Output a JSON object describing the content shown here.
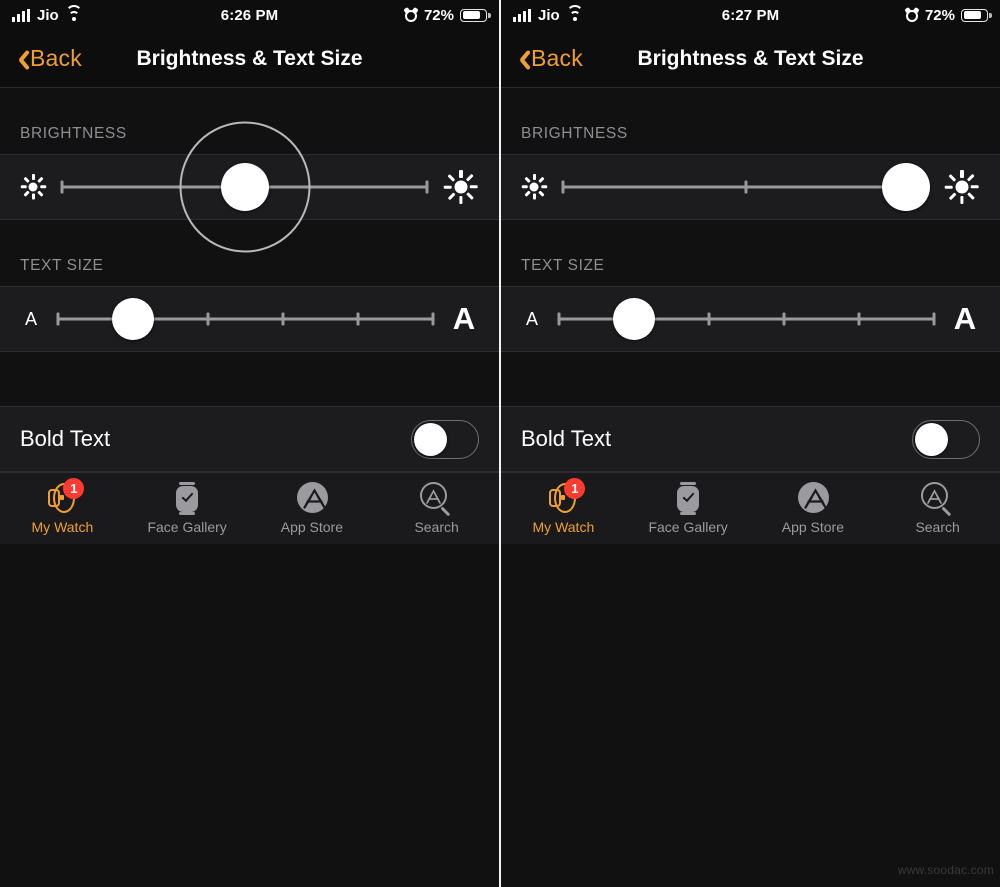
{
  "colors": {
    "accent": "#f0a030",
    "badge": "#ff3b30",
    "screen_bg": "#111111",
    "row_bg": "#1c1c1e",
    "label_gray": "#8e8e93",
    "tab_inactive": "#9a9a9f",
    "knob_white": "#ffffff"
  },
  "panels": [
    {
      "id": "left",
      "status": {
        "carrier": "Jio",
        "time": "6:26 PM",
        "battery_percent": "72%",
        "signal_icon": "signal-bars-icon",
        "wifi_icon": "wifi-icon",
        "alarm_icon": "alarm-clock-icon",
        "battery_icon": "battery-icon"
      },
      "nav": {
        "back_label": "Back",
        "back_icon": "chevron-left-icon",
        "title": "Brightness & Text Size"
      },
      "brightness": {
        "header": "BRIGHTNESS",
        "low_icon": "brightness-low-sun-icon",
        "high_icon": "brightness-high-sun-icon",
        "value_percent": 50,
        "ticks_percent": [
          0,
          100
        ],
        "touch_indicator": true
      },
      "textsize": {
        "header": "TEXT SIZE",
        "small_label": "A",
        "large_label": "A",
        "value_percent": 20,
        "ticks_percent": [
          0,
          20,
          40,
          60,
          80,
          100
        ]
      },
      "bold": {
        "label": "Bold Text",
        "state": "off"
      },
      "tabs": [
        {
          "label": "My Watch",
          "icon": "apple-watch-icon",
          "active": true,
          "badge": "1"
        },
        {
          "label": "Face Gallery",
          "icon": "watch-face-icon",
          "active": false,
          "badge": ""
        },
        {
          "label": "App Store",
          "icon": "app-store-icon",
          "active": false,
          "badge": ""
        },
        {
          "label": "Search",
          "icon": "search-store-icon",
          "active": false,
          "badge": ""
        }
      ]
    },
    {
      "id": "right",
      "status": {
        "carrier": "Jio",
        "time": "6:27 PM",
        "battery_percent": "72%",
        "signal_icon": "signal-bars-icon",
        "wifi_icon": "wifi-icon",
        "alarm_icon": "alarm-clock-icon",
        "battery_icon": "battery-icon"
      },
      "nav": {
        "back_label": "Back",
        "back_icon": "chevron-left-icon",
        "title": "Brightness & Text Size"
      },
      "brightness": {
        "header": "BRIGHTNESS",
        "low_icon": "brightness-low-sun-icon",
        "high_icon": "brightness-high-sun-icon",
        "value_percent": 94,
        "ticks_percent": [
          0,
          50
        ],
        "touch_indicator": false
      },
      "textsize": {
        "header": "TEXT SIZE",
        "small_label": "A",
        "large_label": "A",
        "value_percent": 20,
        "ticks_percent": [
          0,
          20,
          40,
          60,
          80,
          100
        ]
      },
      "bold": {
        "label": "Bold Text",
        "state": "off"
      },
      "tabs": [
        {
          "label": "My Watch",
          "icon": "apple-watch-icon",
          "active": true,
          "badge": "1"
        },
        {
          "label": "Face Gallery",
          "icon": "watch-face-icon",
          "active": false,
          "badge": ""
        },
        {
          "label": "App Store",
          "icon": "app-store-icon",
          "active": false,
          "badge": ""
        },
        {
          "label": "Search",
          "icon": "search-store-icon",
          "active": false,
          "badge": ""
        }
      ]
    }
  ],
  "watermark": "www.soodac.com"
}
